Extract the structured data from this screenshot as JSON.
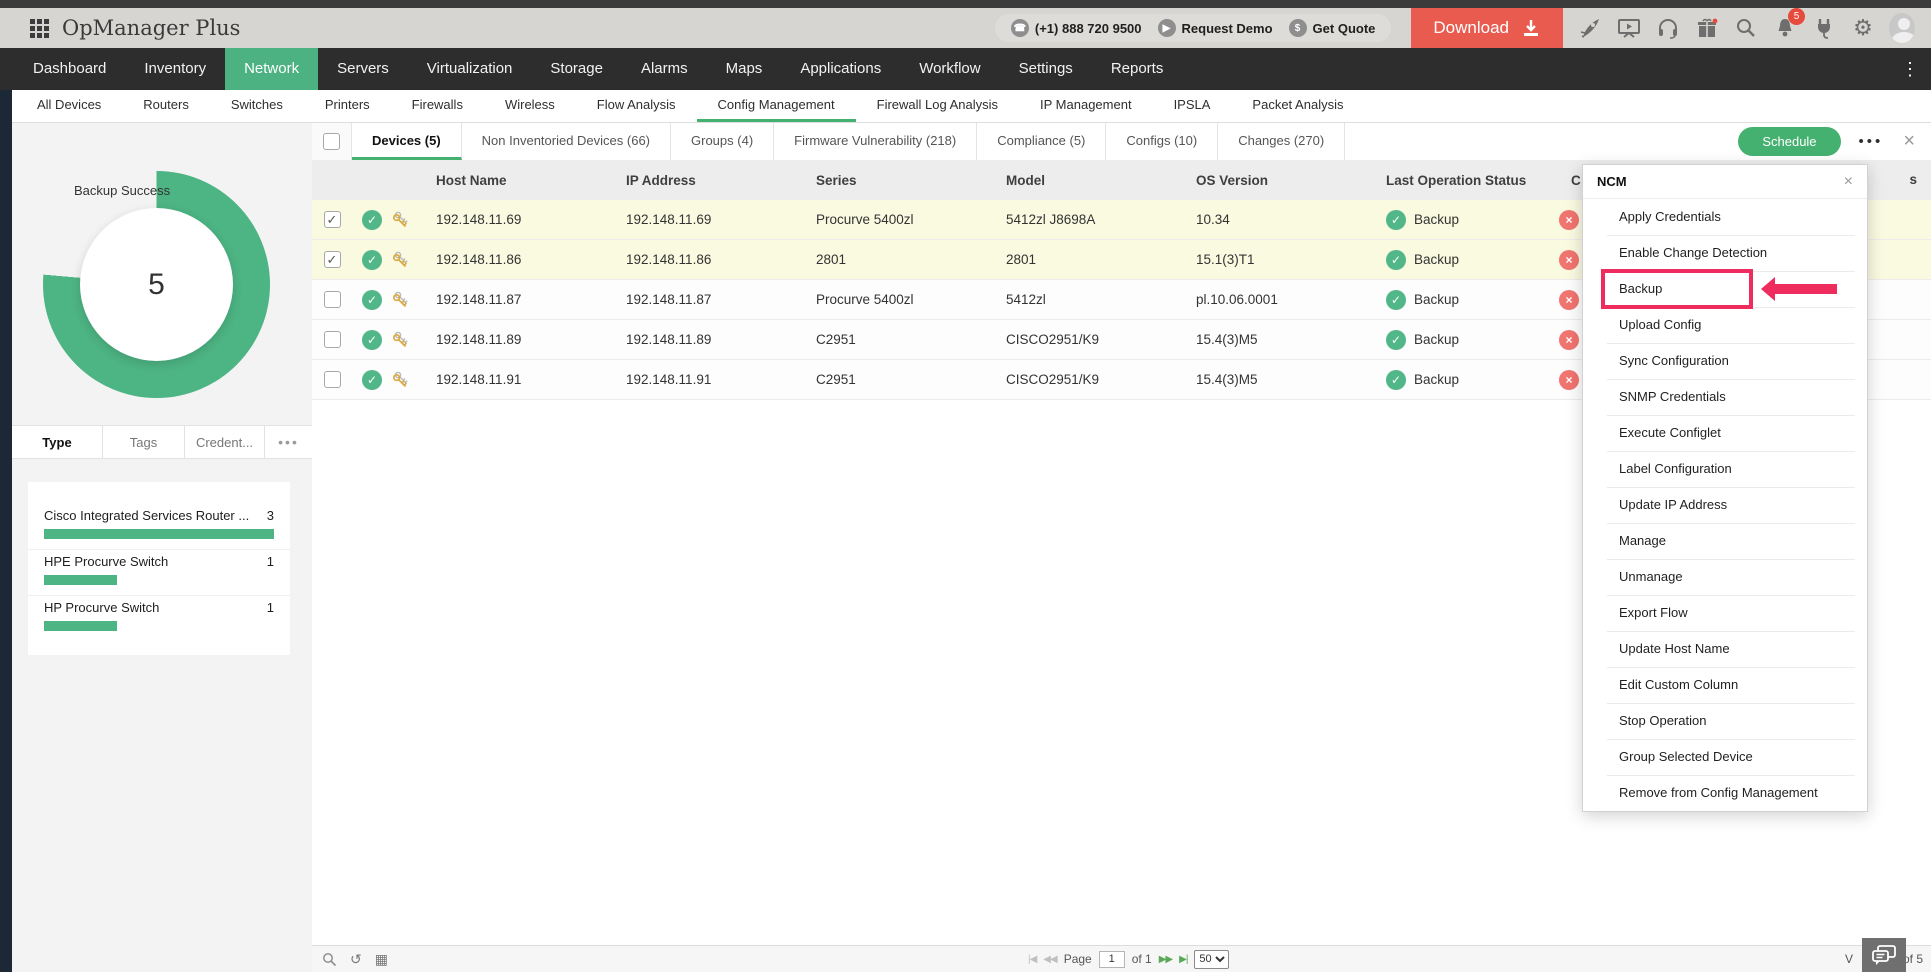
{
  "header": {
    "app_title": "OpManager Plus",
    "phone": "(+1) 888 720 9500",
    "request_demo": "Request Demo",
    "get_quote": "Get Quote",
    "download_label": "Download",
    "notification_count": "5"
  },
  "nav": {
    "active": "Network",
    "items": [
      "Dashboard",
      "Inventory",
      "Network",
      "Servers",
      "Virtualization",
      "Storage",
      "Alarms",
      "Maps",
      "Applications",
      "Workflow",
      "Settings",
      "Reports"
    ]
  },
  "subnav": {
    "active": "Config Management",
    "items": [
      "All Devices",
      "Routers",
      "Switches",
      "Printers",
      "Firewalls",
      "Wireless",
      "Flow Analysis",
      "Config Management",
      "Firewall Log Analysis",
      "IP Management",
      "IPSLA",
      "Packet Analysis"
    ]
  },
  "tabs": {
    "active": "Devices (5)",
    "items": [
      "Devices (5)",
      "Non Inventoried Devices (66)",
      "Groups (4)",
      "Firmware Vulnerability (218)",
      "Compliance (5)",
      "Configs (10)",
      "Changes (270)"
    ],
    "schedule_label": "Schedule",
    "more_label": "•••",
    "close_label": "×"
  },
  "sidebar": {
    "chart": {
      "label": "Backup Success",
      "value": "5",
      "color": "#4db483"
    },
    "tabs": {
      "type": "Type",
      "tags": "Tags",
      "credentials": "Credent...",
      "more": "•••"
    },
    "type_list": [
      {
        "name": "Cisco Integrated Services Router ...",
        "count": "3"
      },
      {
        "name": "HPE Procurve Switch",
        "count": "1"
      },
      {
        "name": "HP Procurve Switch",
        "count": "1"
      }
    ]
  },
  "table": {
    "columns": {
      "host": "Host Name",
      "ip": "IP Address",
      "series": "Series",
      "model": "Model",
      "os": "OS Version",
      "lastop": "Last Operation Status",
      "partial_left": "C",
      "partial_right": "s"
    },
    "rows": [
      {
        "host": "192.148.11.69",
        "ip": "192.148.11.69",
        "series": "Procurve 5400zl",
        "model": "5412zl J8698A",
        "os": "10.34",
        "status": "Backup",
        "checked": true
      },
      {
        "host": "192.148.11.86",
        "ip": "192.148.11.86",
        "series": "2801",
        "model": "2801",
        "os": "15.1(3)T1",
        "status": "Backup",
        "checked": true
      },
      {
        "host": "192.148.11.87",
        "ip": "192.148.11.87",
        "series": "Procurve 5400zl",
        "model": "5412zl",
        "os": "pl.10.06.0001",
        "status": "Backup",
        "checked": false
      },
      {
        "host": "192.148.11.89",
        "ip": "192.148.11.89",
        "series": "C2951",
        "model": "CISCO2951/K9",
        "os": "15.4(3)M5",
        "status": "Backup",
        "checked": false
      },
      {
        "host": "192.148.11.91",
        "ip": "192.148.11.91",
        "series": "C2951",
        "model": "CISCO2951/K9",
        "os": "15.4(3)M5",
        "status": "Backup",
        "checked": false
      }
    ]
  },
  "menu": {
    "title": "NCM",
    "highlighted": "Backup",
    "items": [
      "Apply Credentials",
      "Enable Change Detection",
      "Backup",
      "Upload Config",
      "Sync Configuration",
      "SNMP Credentials",
      "Execute Configlet",
      "Label Configuration",
      "Update IP Address",
      "Manage",
      "Unmanage",
      "Export Flow",
      "Update Host Name",
      "Edit Custom Column",
      "Stop Operation",
      "Group Selected Device",
      "Remove from Config Management"
    ]
  },
  "footer": {
    "page_label": "Page",
    "page_value": "1",
    "of_label": "of 1",
    "page_size": "50",
    "back_first": "|◀",
    "back_prev": "◀◀",
    "fwd_next": "▶▶",
    "fwd_last": "▶|",
    "records_prefix": "V",
    "records_suffix": "of 5"
  },
  "colors": {
    "accent_green": "#45b171",
    "donut_green": "#4db483",
    "download_red": "#e85b4e",
    "highlight_pink": "#ee2c5e",
    "selected_row": "#fafae1"
  }
}
